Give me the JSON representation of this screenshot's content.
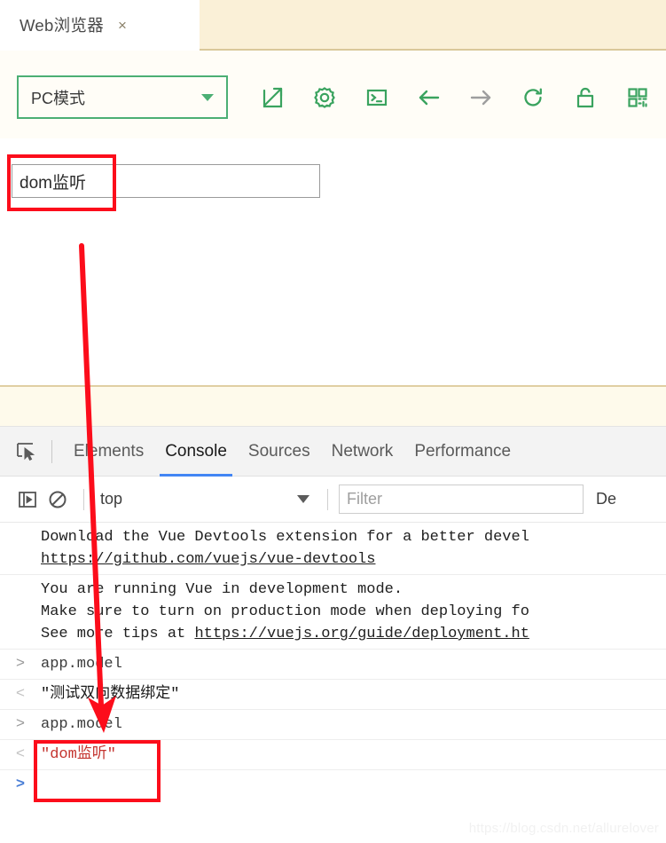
{
  "browser": {
    "tab": {
      "title": "Web浏览器",
      "close_label": "×"
    },
    "toolbar": {
      "mode_select_value": "PC模式",
      "icons": [
        {
          "name": "external-link-icon",
          "title": "在新窗口打开"
        },
        {
          "name": "gear-icon",
          "title": "设置"
        },
        {
          "name": "terminal-icon",
          "title": "控制台"
        },
        {
          "name": "arrow-back-icon",
          "title": "后退"
        },
        {
          "name": "arrow-forward-icon",
          "title": "前进"
        },
        {
          "name": "reload-icon",
          "title": "刷新"
        },
        {
          "name": "lock-icon",
          "title": "安全"
        },
        {
          "name": "qr-code-icon",
          "title": "二维码"
        }
      ]
    }
  },
  "page": {
    "input_value": "dom监听",
    "input_placeholder": ""
  },
  "devtools": {
    "tabs": [
      {
        "label": "Elements",
        "active": false
      },
      {
        "label": "Console",
        "active": true
      },
      {
        "label": "Sources",
        "active": false
      },
      {
        "label": "Network",
        "active": false
      },
      {
        "label": "Performance",
        "active": false
      }
    ],
    "console_toolbar": {
      "sidebar_toggle_icon": "sidebar-toggle-icon",
      "clear_icon": "clear-console-icon",
      "context": "top",
      "filter_placeholder": "Filter",
      "levels_label": "De"
    },
    "messages": [
      {
        "lines": [
          "Download the Vue Devtools extension for a better devel",
          "https://github.com/vuejs/vue-devtools"
        ],
        "underlined": [
          false,
          true
        ]
      },
      {
        "lines": [
          "You are running Vue in development mode.",
          "Make sure to turn on production mode when deploying fo",
          "See more tips at https://vuejs.org/guide/deployment.ht"
        ],
        "underlined": [
          false,
          false,
          false
        ]
      }
    ],
    "entries": [
      {
        "gutter": ">",
        "kind": "input",
        "text": "app.model"
      },
      {
        "gutter": "<",
        "kind": "result",
        "text": "\"测试双向数据绑定\""
      },
      {
        "gutter": ">",
        "kind": "input",
        "text": "app.model"
      },
      {
        "gutter": "<",
        "kind": "result-red",
        "text": "\"dom监听\""
      },
      {
        "gutter": ">",
        "kind": "prompt",
        "text": ""
      }
    ]
  },
  "annotations": {
    "highlight_color": "#fc0d1b",
    "arrow_from": "page input field",
    "arrow_to": "console result line"
  },
  "watermark": "https://blog.csdn.net/allurelover"
}
